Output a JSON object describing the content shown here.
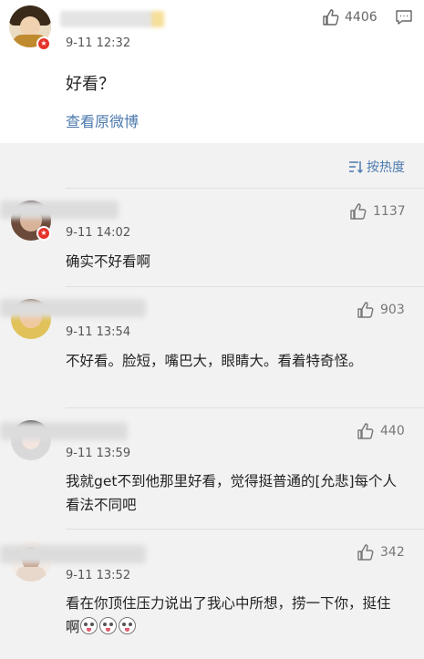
{
  "post": {
    "time": "9-11 12:32",
    "like_count": "4406",
    "content": "好看？",
    "view_original": "查看原微博"
  },
  "sort": {
    "label": "按热度"
  },
  "comments": [
    {
      "time": "9-11 14:02",
      "likes": "1137",
      "text": "确实不好看啊"
    },
    {
      "time": "9-11 13:54",
      "likes": "903",
      "text": "不好看。脸短，嘴巴大，眼睛大。看着特奇怪。"
    },
    {
      "time": "9-11 13:59",
      "likes": "440",
      "text": "我就get不到他那里好看，觉得挺普通的[允悲]每个人看法不同吧"
    },
    {
      "time": "9-11 13:52",
      "likes": "342",
      "text": "看在你顶住压力说出了我心中所想，捞一下你，挺住啊"
    }
  ],
  "colors": {
    "link": "#4d7aae",
    "badge": "#e5332a",
    "background": "#f2f2f2"
  },
  "icons": {
    "like": "thumbs-up-icon",
    "comment": "comment-icon",
    "sort": "sort-icon",
    "verified": "verified-badge-icon"
  }
}
